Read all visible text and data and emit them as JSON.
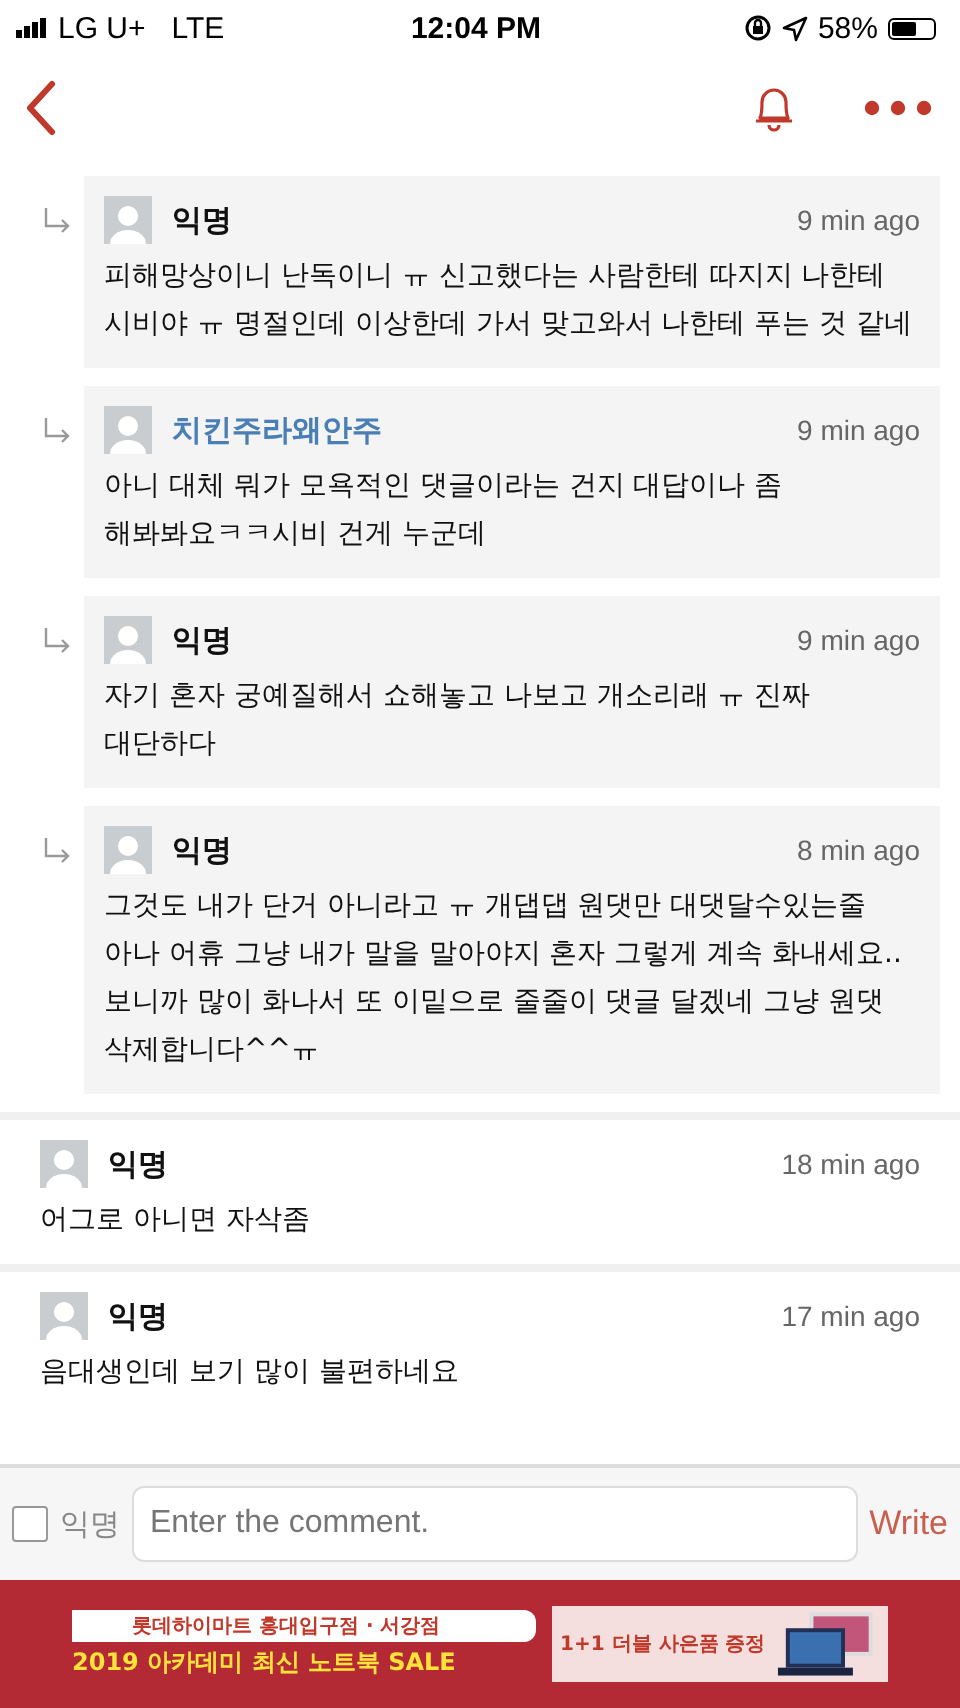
{
  "status_bar": {
    "carrier": "LG U+",
    "network": "LTE",
    "time": "12:04 PM",
    "battery": "58%"
  },
  "comments": [
    {
      "kind": "reply",
      "author": "익명",
      "color": "#111111",
      "time": "9 min ago",
      "text": "피해망상이니 난독이니 ㅠ 신고했다는 사람한테 따지지 나한테 시비야 ㅠ 명절인데 이상한데 가서 맞고와서 나한테 푸는 것 같네"
    },
    {
      "kind": "reply",
      "author": "치킨주라왜안주",
      "color": "#4a7fb5",
      "time": "9 min ago",
      "text": "아니 대체 뭐가 모욕적인 댓글이라는 건지 대답이나 좀 해봐봐요ㅋㅋ시비 건게 누군데"
    },
    {
      "kind": "reply",
      "author": "익명",
      "color": "#111111",
      "time": "9 min ago",
      "text": "자기 혼자 궁예질해서 쇼해놓고 나보고 개소리래 ㅠ 진짜 대단하다"
    },
    {
      "kind": "reply",
      "author": "익명",
      "color": "#111111",
      "time": "8 min ago",
      "text": "그것도 내가 단거 아니라고 ㅠ 개댑댑 원댓만 대댓달수있는줄 아나 어휴 그냥 내가 말을 말아야지 혼자 그렇게 계속 화내세요.. 보니까 많이 화나서 또 이밑으로 줄줄이 댓글 달겠네 그냥 원댓 삭제합니다^^ㅠ"
    },
    {
      "kind": "comment",
      "author": "익명",
      "color": "#111111",
      "time": "18 min ago",
      "text": "어그로 아니면 자삭좀"
    },
    {
      "kind": "comment",
      "author": "익명",
      "color": "#111111",
      "time": "17 min ago",
      "text": "음대생인데 보기 많이 불편하네요"
    }
  ],
  "composer": {
    "anonymous_label": "익명",
    "anonymous_checked": false,
    "placeholder": "Enter the comment.",
    "submit": "Write"
  },
  "ad": {
    "store": "롯데하이마트 홍대입구점 · 서강점",
    "headline": "2019 아카데미 최신 노트북 SALE",
    "offer": "1+1 더블 사은품 증정"
  }
}
